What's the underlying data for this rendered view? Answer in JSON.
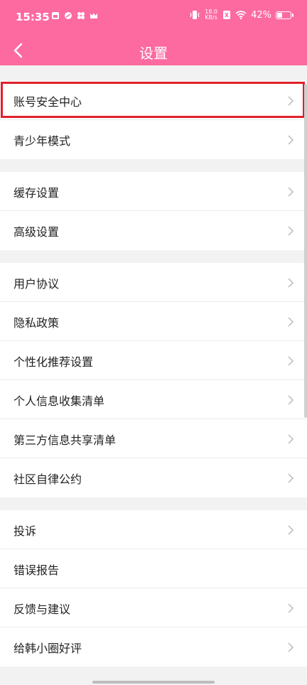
{
  "status_bar": {
    "time": "15:35",
    "speed_top": "18.0",
    "speed_bottom": "KB/s",
    "battery_percent_text": "42%",
    "battery_level": 0.42
  },
  "nav": {
    "title": "设置"
  },
  "groups": [
    {
      "items": [
        {
          "label": "账号安全中心"
        },
        {
          "label": "青少年模式"
        }
      ]
    },
    {
      "items": [
        {
          "label": "缓存设置"
        },
        {
          "label": "高级设置"
        }
      ]
    },
    {
      "items": [
        {
          "label": "用户协议"
        },
        {
          "label": "隐私政策"
        },
        {
          "label": "个性化推荐设置"
        },
        {
          "label": "个人信息收集清单"
        },
        {
          "label": "第三方信息共享清单"
        },
        {
          "label": "社区自律公约"
        }
      ]
    },
    {
      "items": [
        {
          "label": "投诉"
        },
        {
          "label": "错误报告"
        },
        {
          "label": "反馈与建议"
        },
        {
          "label": "给韩小圈好评"
        }
      ]
    }
  ],
  "colors": {
    "header": "#fd6aa0",
    "highlight": "#e0202a"
  }
}
